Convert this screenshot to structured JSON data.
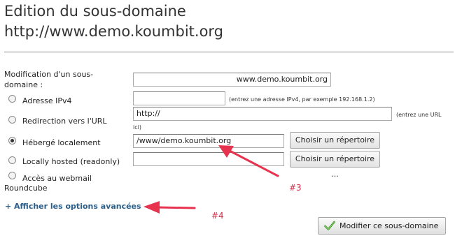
{
  "page": {
    "title_line1": "Edition du sous-domaine",
    "title_line2": "http://www.demo.koumbit.org"
  },
  "form": {
    "subdomain_label_line1": "Modification d'un sous-",
    "subdomain_label_line2": "domaine :",
    "subdomain_value": "www.demo.koumbit.org",
    "options": [
      {
        "label": "Adresse IPv4",
        "selected": false,
        "value": "",
        "hint": "(entrez une adresse IPv4, par exemple 192.168.1.2)"
      },
      {
        "label": "Redirection vers l'URL",
        "selected": false,
        "value": "http://",
        "hint_line1": "(entrez une URL",
        "hint_line2": "ici)"
      },
      {
        "label": "Hébergé localement",
        "selected": true,
        "value": "/www/demo.koumbit.org",
        "button": "Choisir un répertoire ..."
      },
      {
        "label": "Locally hosted (readonly)",
        "selected": false,
        "value": "",
        "button": "Choisir un répertoire ..."
      },
      {
        "label_line1": "Accès au webmail",
        "label_line2": "Roundcube",
        "selected": false
      }
    ],
    "advanced_link": "+ Afficher les options avancées",
    "submit_label": "Modifier ce sous-domaine"
  },
  "annotations": {
    "arrow_3_label": "#3",
    "arrow_4_label": "#4",
    "arrow_color": "#e8334f"
  }
}
